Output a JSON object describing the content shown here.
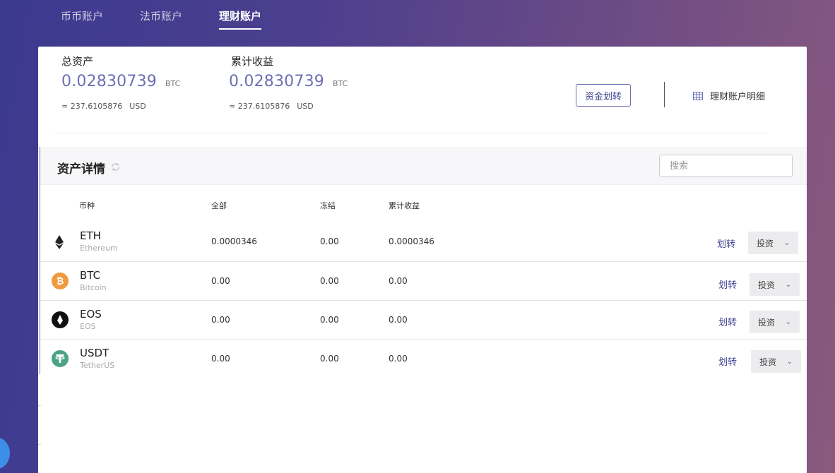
{
  "tabs": [
    {
      "label": "币币账户",
      "active": false
    },
    {
      "label": "法币账户",
      "active": false
    },
    {
      "label": "理财账户",
      "active": true
    }
  ],
  "summary": {
    "total": {
      "label": "总资产",
      "value": "0.02830739",
      "unit": "BTC",
      "usd_approx": "≈ 237.6105876",
      "usd_unit": "USD"
    },
    "earnings": {
      "label": "累计收益",
      "value": "0.02830739",
      "unit": "BTC",
      "usd_approx": "≈ 237.6105876",
      "usd_unit": "USD"
    },
    "transfer_button": "资金划转",
    "detail_link": "理财账户明细"
  },
  "assets": {
    "title": "资产详情",
    "search_placeholder": "搜索",
    "columns": [
      "币种",
      "全部",
      "冻结",
      "累计收益"
    ],
    "rows": [
      {
        "symbol": "ETH",
        "name": "Ethereum",
        "icon": "eth-icon",
        "total": "0.0000346",
        "frozen": "0.00",
        "earnings": "0.0000346",
        "transfer": "划转",
        "invest": "投资"
      },
      {
        "symbol": "BTC",
        "name": "Bitcoin",
        "icon": "btc-icon",
        "total": "0.00",
        "frozen": "0.00",
        "earnings": "0.00",
        "transfer": "划转",
        "invest": "投资"
      },
      {
        "symbol": "EOS",
        "name": "EOS",
        "icon": "eos-icon",
        "total": "0.00",
        "frozen": "0.00",
        "earnings": "0.00",
        "transfer": "划转",
        "invest": "投资"
      },
      {
        "symbol": "USDT",
        "name": "TetherUS",
        "icon": "usdt-icon",
        "total": "0.00",
        "frozen": "0.00",
        "earnings": "0.00",
        "transfer": "划转",
        "invest": "投资"
      }
    ]
  },
  "colors": {
    "accent": "#6c6fb3",
    "link": "#3b3d8f",
    "btc": "#f09a3e",
    "usdt": "#4aa383",
    "float_button": "#3d8ee6"
  }
}
